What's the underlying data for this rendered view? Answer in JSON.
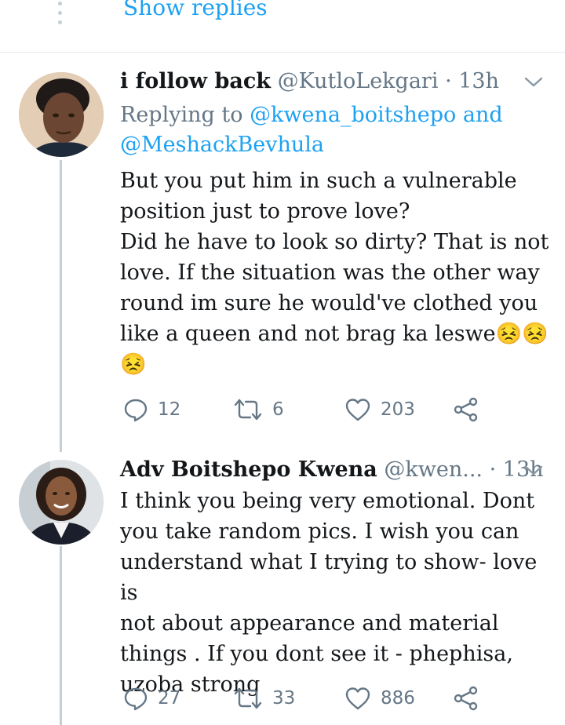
{
  "top": {
    "show_replies": "Show replies"
  },
  "tweets": [
    {
      "name": "i follow back",
      "handle": "@KutloLekgari",
      "separator": "·",
      "time": "13h",
      "replying_prefix": "Replying to",
      "replying_mention_1": "@kwena_boitshepo",
      "replying_and": "and",
      "replying_mention_2": "@MeshackBevhula",
      "text": "But you put him in such a vulnerable\nposition just to prove love?\nDid he have to look so dirty? That is not\nlove. If the situation was the other way\nround im sure he would've clothed you\nlike a queen and not brag ka leswe😣😣\n😣",
      "replies": "12",
      "retweets": "6",
      "likes": "203"
    },
    {
      "name": "Adv Boitshepo Kwena",
      "handle": "@kwen...",
      "separator": "·",
      "time": "13h",
      "text": "I think you being very emotional.  Dont\nyou take random pics. I wish you can\nunderstand what I trying to show- love is\nnot about appearance and material\nthings . If you dont see it - phephisa,\nuzoba strong",
      "replies": "27",
      "retweets": "33",
      "likes": "886"
    }
  ],
  "icons": {
    "reply": "speech-bubble-icon",
    "retweet": "retweet-icon",
    "like": "heart-icon",
    "share": "share-icon",
    "caret": "chevron-down-icon"
  },
  "colors": {
    "link": "#1da1f2",
    "secondary": "#657786",
    "text": "#14171a",
    "thread_line": "#c4cfd6"
  }
}
